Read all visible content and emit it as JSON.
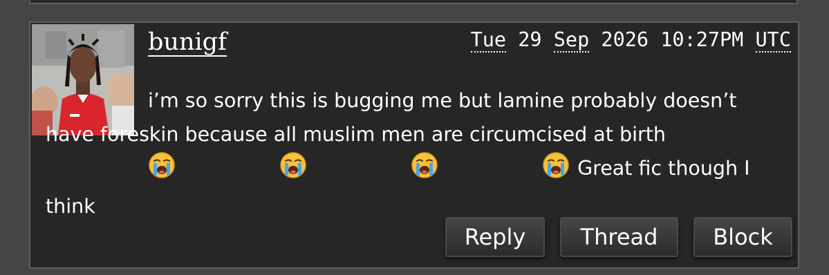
{
  "comment": {
    "username": "bunigf",
    "timestamp": {
      "weekday": "Tue",
      "day": "29",
      "month": "Sep",
      "year": "2026",
      "time": "10:27PM",
      "timezone": "UTC"
    },
    "text_before_emoji": "i’m so sorry this is bugging me but lamine probably doesn’t have foreskin because all muslim men are circumcised at birth",
    "emoji_icon": "loudly-crying-face-icon",
    "emoji_count": 4,
    "text_after_emoji": "Great fic though I think",
    "avatar_icon": "user-avatar-photo"
  },
  "actions": {
    "reply_label": "Reply",
    "thread_label": "Thread",
    "block_label": "Block"
  },
  "colors": {
    "page_background": "#454545",
    "panel_background": "#262626",
    "panel_border": "#5e5e5e",
    "text": "#ffffff",
    "emoji_face": "#f5c23c",
    "emoji_tears": "#4aa3e8"
  }
}
